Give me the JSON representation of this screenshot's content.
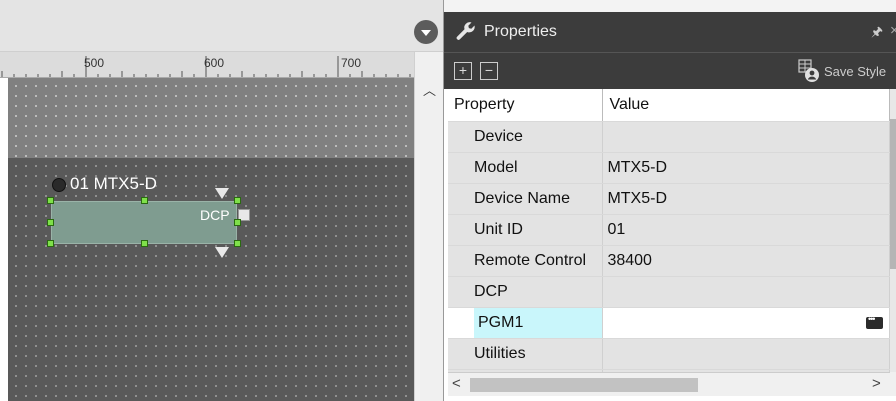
{
  "canvas": {
    "ruler_labels": [
      "500",
      "600",
      "700"
    ],
    "device": {
      "title": "01 MTX5-D",
      "port_label": "DCP"
    }
  },
  "properties_panel": {
    "title": "Properties",
    "pin_glyph": "🖈",
    "close_glyph": "×",
    "toolbar": {
      "expand_glyph": "+",
      "collapse_glyph": "−",
      "save_style_label": "Save Style"
    },
    "columns": {
      "property": "Property",
      "value": "Value"
    },
    "rows": [
      {
        "type": "category",
        "property": "Device",
        "value": ""
      },
      {
        "type": "item",
        "property": "Model",
        "value": "MTX5-D"
      },
      {
        "type": "item",
        "property": "Device Name",
        "value": "MTX5-D"
      },
      {
        "type": "item",
        "property": "Unit ID",
        "value": "01"
      },
      {
        "type": "item",
        "property": "Remote Control",
        "value": "38400"
      },
      {
        "type": "category",
        "property": "DCP",
        "value": ""
      },
      {
        "type": "selected",
        "property": "PGM1",
        "value": ""
      },
      {
        "type": "category",
        "property": "Utilities",
        "value": ""
      }
    ],
    "scroll_left_glyph": "<",
    "scroll_right_glyph": ">"
  },
  "colors": {
    "panel_header": "#3c3c3c",
    "selected_cell": "#c9f6fb",
    "handle": "#7fe04a",
    "device_box": "#7f9c90"
  },
  "icons": [
    "chevron-down-icon",
    "wrench-icon",
    "pin-icon",
    "close-icon",
    "expand-all-icon",
    "collapse-all-icon",
    "save-style-icon",
    "ellipsis-icon"
  ]
}
